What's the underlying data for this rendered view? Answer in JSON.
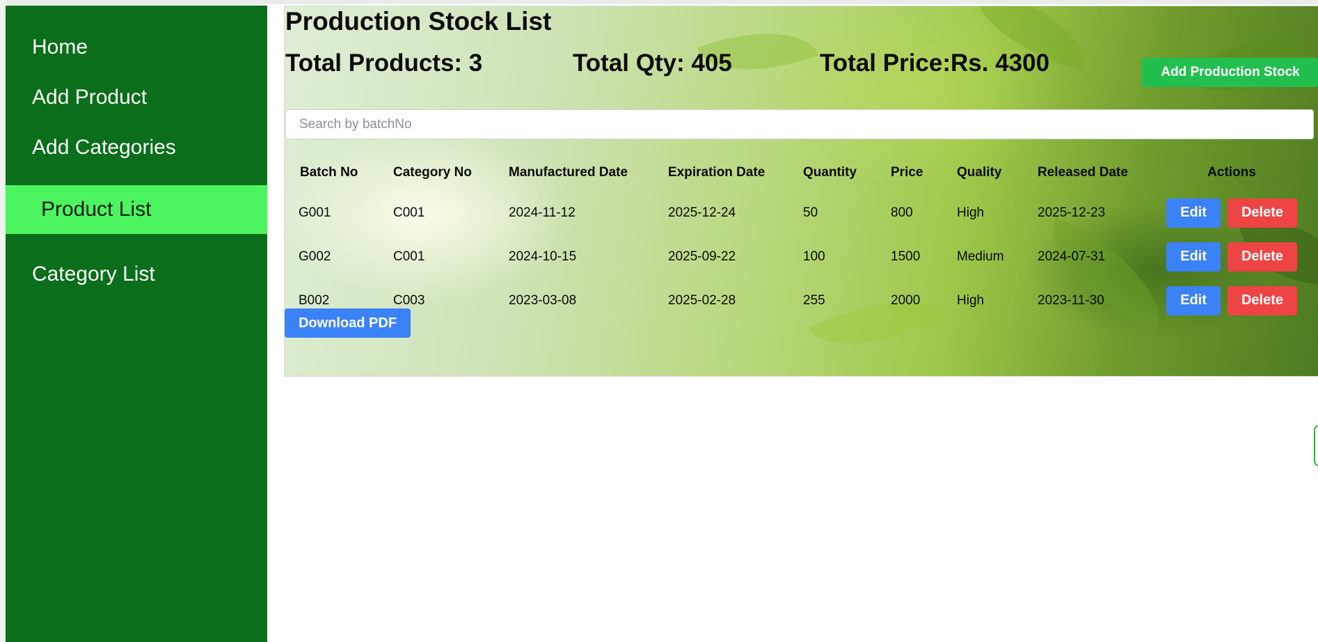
{
  "sidebar": {
    "items": [
      {
        "label": "Home"
      },
      {
        "label": "Add Product"
      },
      {
        "label": "Add Categories"
      },
      {
        "label": "Product List",
        "active": true
      },
      {
        "label": "Category List"
      }
    ]
  },
  "page": {
    "title": "Production Stock List",
    "total_products": "Total Products: 3",
    "total_qty": "Total Qty: 405",
    "total_price": "Total Price:Rs. 4300",
    "add_button": "Add Production Stock",
    "download_button": "Download PDF"
  },
  "search": {
    "placeholder": "Search by batchNo",
    "value": ""
  },
  "table": {
    "headers": [
      "Batch No",
      "Category No",
      "Manufactured Date",
      "Expiration Date",
      "Quantity",
      "Price",
      "Quality",
      "Released Date",
      "Actions"
    ],
    "rows": [
      [
        "G001",
        "C001",
        "2024-11-12",
        "2025-12-24",
        "50",
        "800",
        "High",
        "2025-12-23"
      ],
      [
        "G002",
        "C001",
        "2024-10-15",
        "2025-09-22",
        "100",
        "1500",
        "Medium",
        "2024-07-31"
      ],
      [
        "B002",
        "C003",
        "2023-03-08",
        "2025-02-28",
        "255",
        "2000",
        "High",
        "2023-11-30"
      ]
    ],
    "edit_label": "Edit",
    "delete_label": "Delete"
  },
  "colors": {
    "sidebar_bg": "#0a6e1a",
    "sidebar_active": "#4cf560",
    "add_button": "#22bf4f",
    "edit_button": "#3b82f6",
    "delete_button": "#ef4444"
  }
}
